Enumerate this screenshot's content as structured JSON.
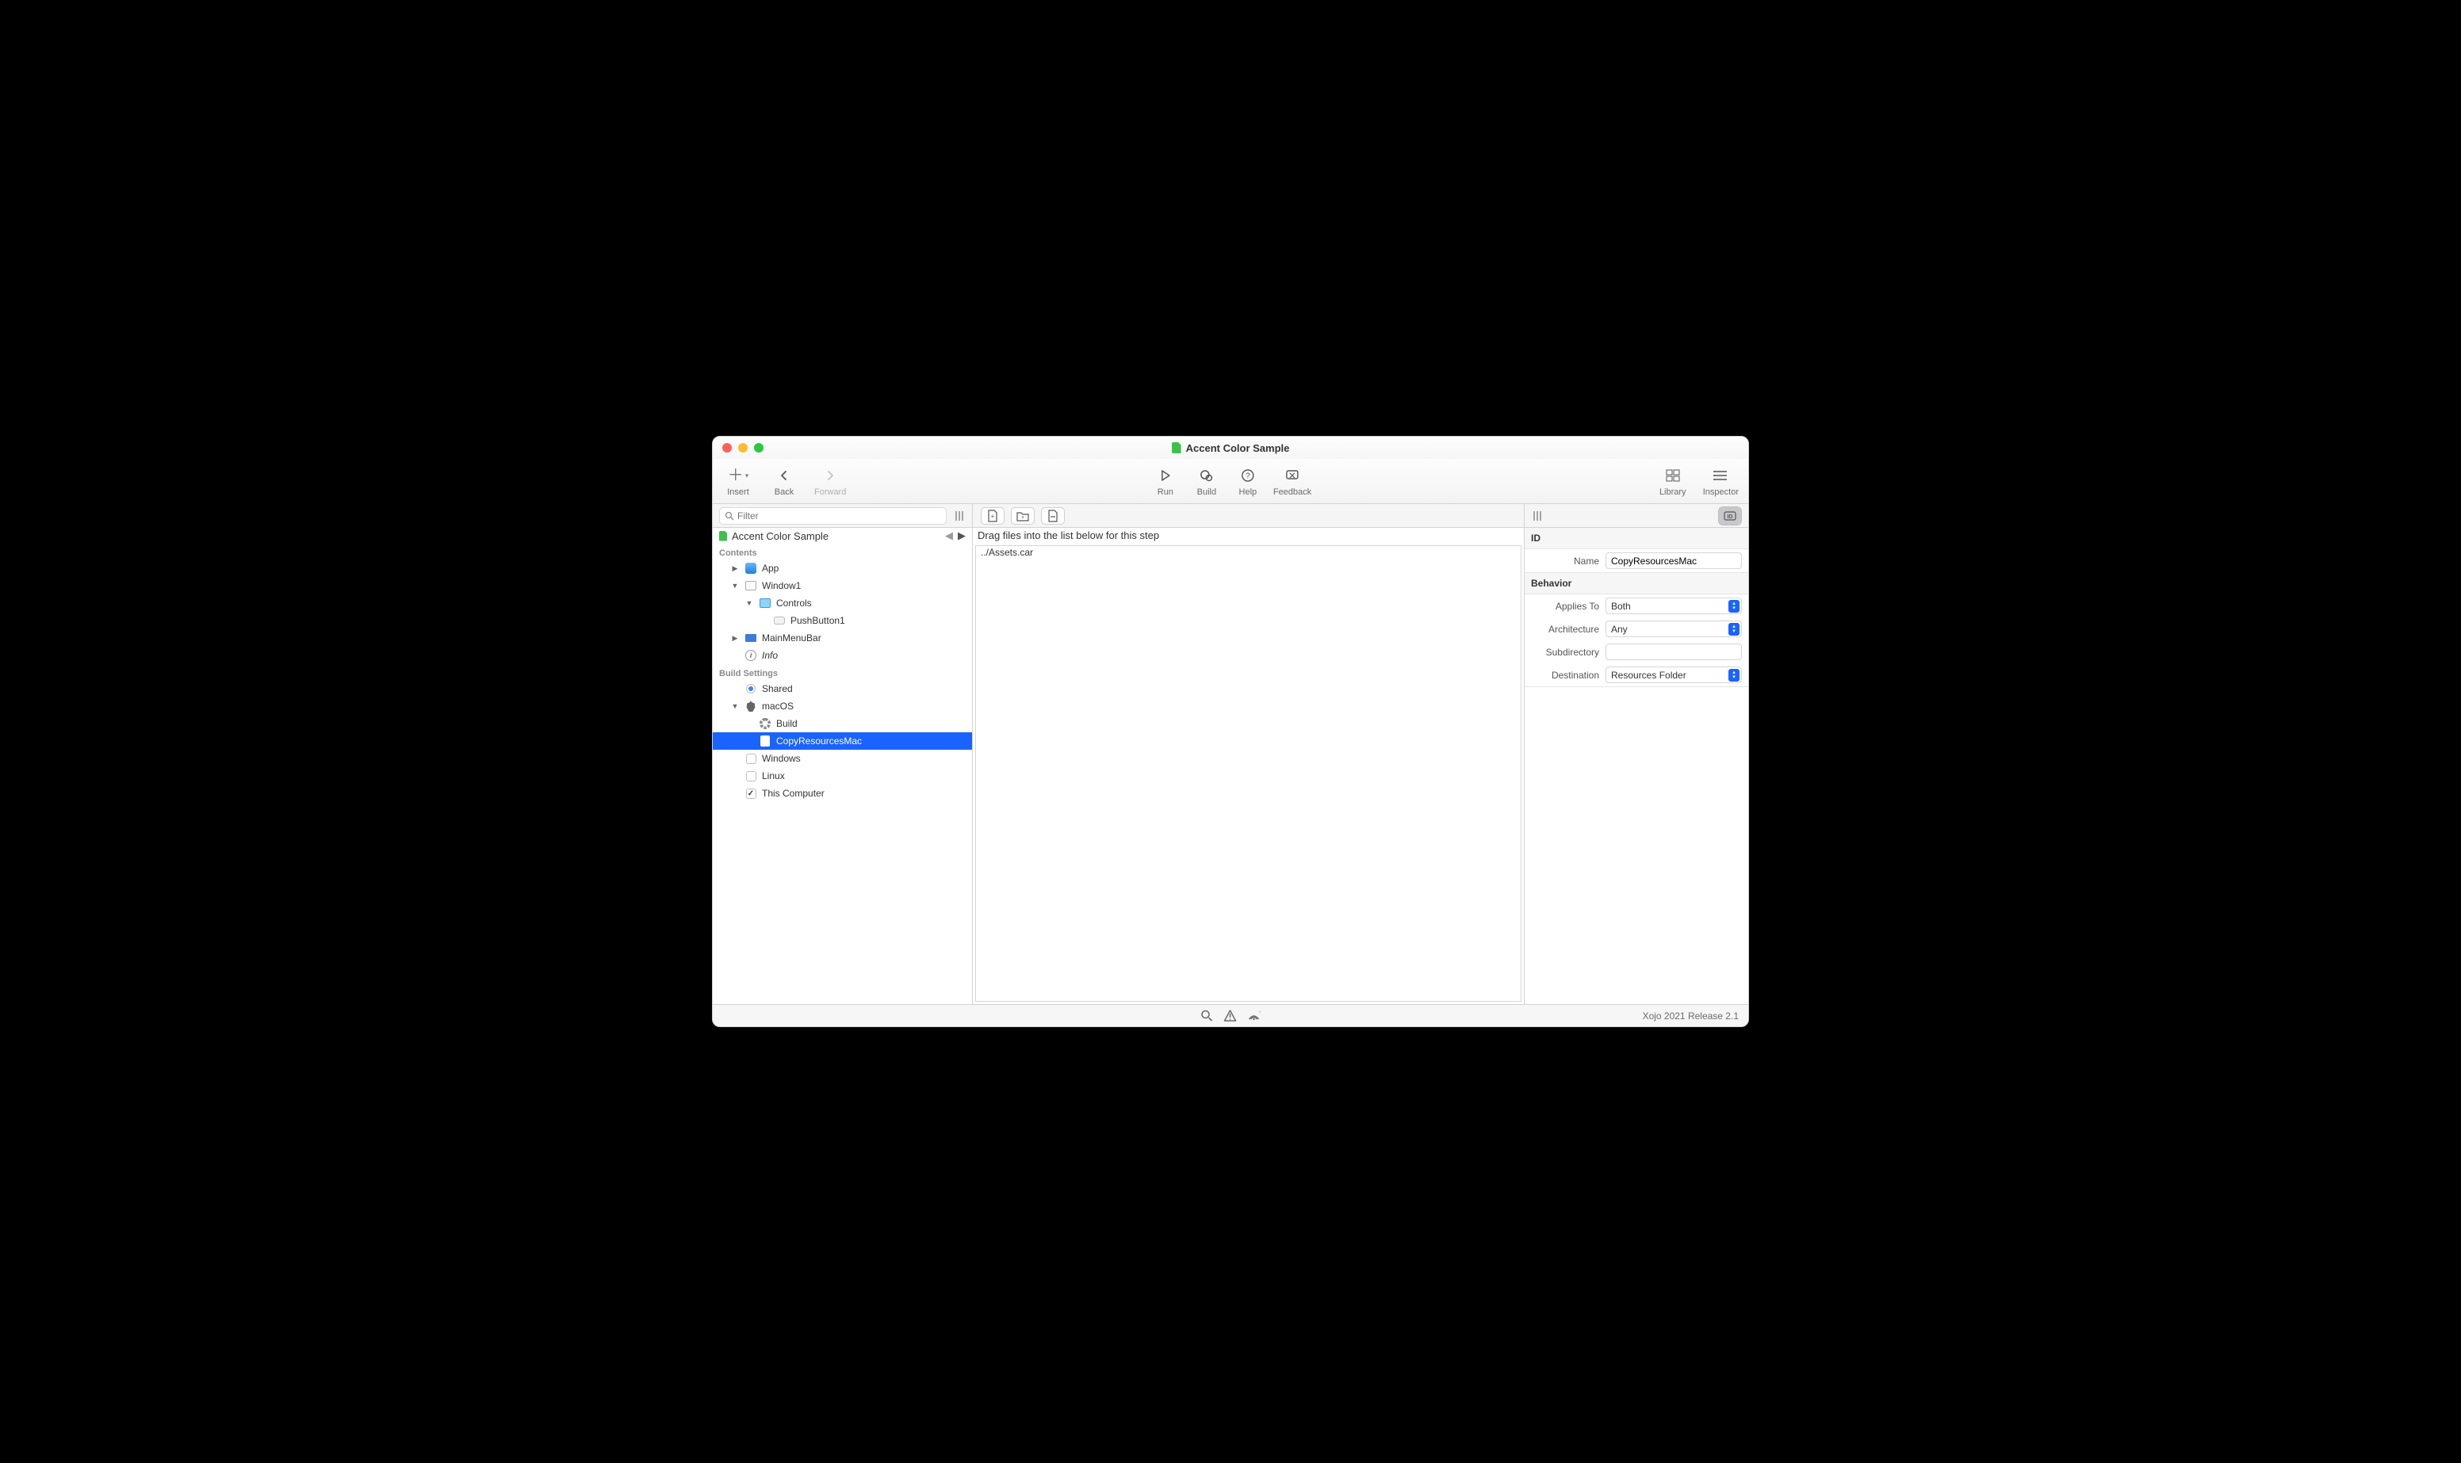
{
  "window": {
    "title": "Accent Color Sample"
  },
  "toolbar": {
    "insert": "Insert",
    "back": "Back",
    "forward": "Forward",
    "run": "Run",
    "build": "Build",
    "help": "Help",
    "feedback": "Feedback",
    "library": "Library",
    "inspector": "Inspector"
  },
  "search": {
    "placeholder": "Filter"
  },
  "project": {
    "root": "Accent Color Sample",
    "contents_label": "Contents",
    "items": {
      "app": "App",
      "window1": "Window1",
      "controls": "Controls",
      "pushbutton1": "PushButton1",
      "mainmenubar": "MainMenuBar",
      "info": "Info"
    },
    "build_label": "Build Settings",
    "build": {
      "shared": "Shared",
      "macos": "macOS",
      "build": "Build",
      "copyresources": "CopyResourcesMac",
      "windows": "Windows",
      "linux": "Linux",
      "thiscomputer": "This Computer"
    }
  },
  "main": {
    "drag_hint": "Drag files into the list below for this step",
    "files": [
      "../Assets.car"
    ]
  },
  "inspector": {
    "id_section": "ID",
    "name_label": "Name",
    "name_value": "CopyResourcesMac",
    "behavior_section": "Behavior",
    "applies_label": "Applies To",
    "applies_value": "Both",
    "arch_label": "Architecture",
    "arch_value": "Any",
    "subdir_label": "Subdirectory",
    "subdir_value": "",
    "dest_label": "Destination",
    "dest_value": "Resources Folder"
  },
  "status": {
    "version": "Xojo 2021 Release 2.1"
  }
}
